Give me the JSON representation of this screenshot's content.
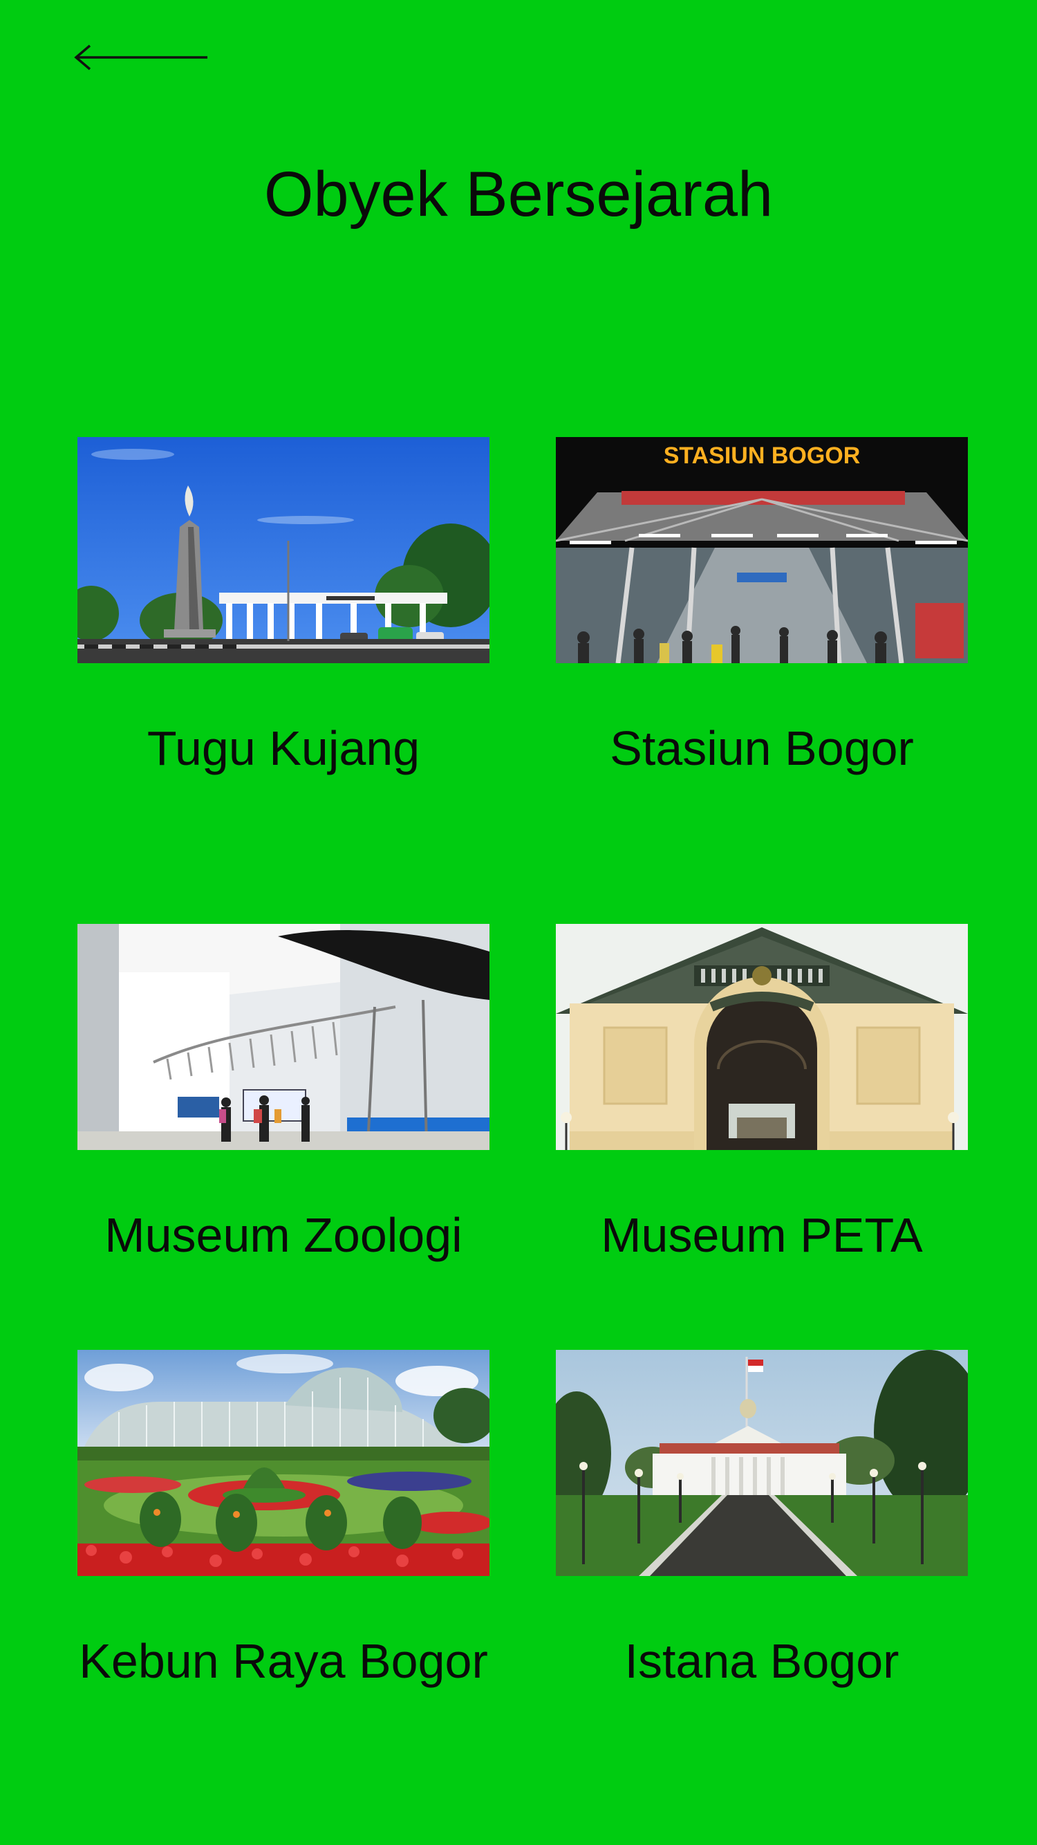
{
  "header": {
    "back_icon": "arrow-left-icon",
    "title": "Obyek Bersejarah"
  },
  "places": [
    {
      "name": "Tugu Kujang",
      "image": "tugu-kujang-photo"
    },
    {
      "name": "Stasiun Bogor",
      "image": "stasiun-bogor-photo",
      "sign_text": "STASIUN BOGOR"
    },
    {
      "name": "Museum Zoologi",
      "image": "museum-zoologi-photo"
    },
    {
      "name": "Museum PETA",
      "image": "museum-peta-photo"
    },
    {
      "name": "Kebun Raya Bogor",
      "image": "kebun-raya-bogor-photo"
    },
    {
      "name": "Istana Bogor",
      "image": "istana-bogor-photo"
    }
  ],
  "colors": {
    "background": "#00cc11",
    "text": "#0a0a0a"
  }
}
